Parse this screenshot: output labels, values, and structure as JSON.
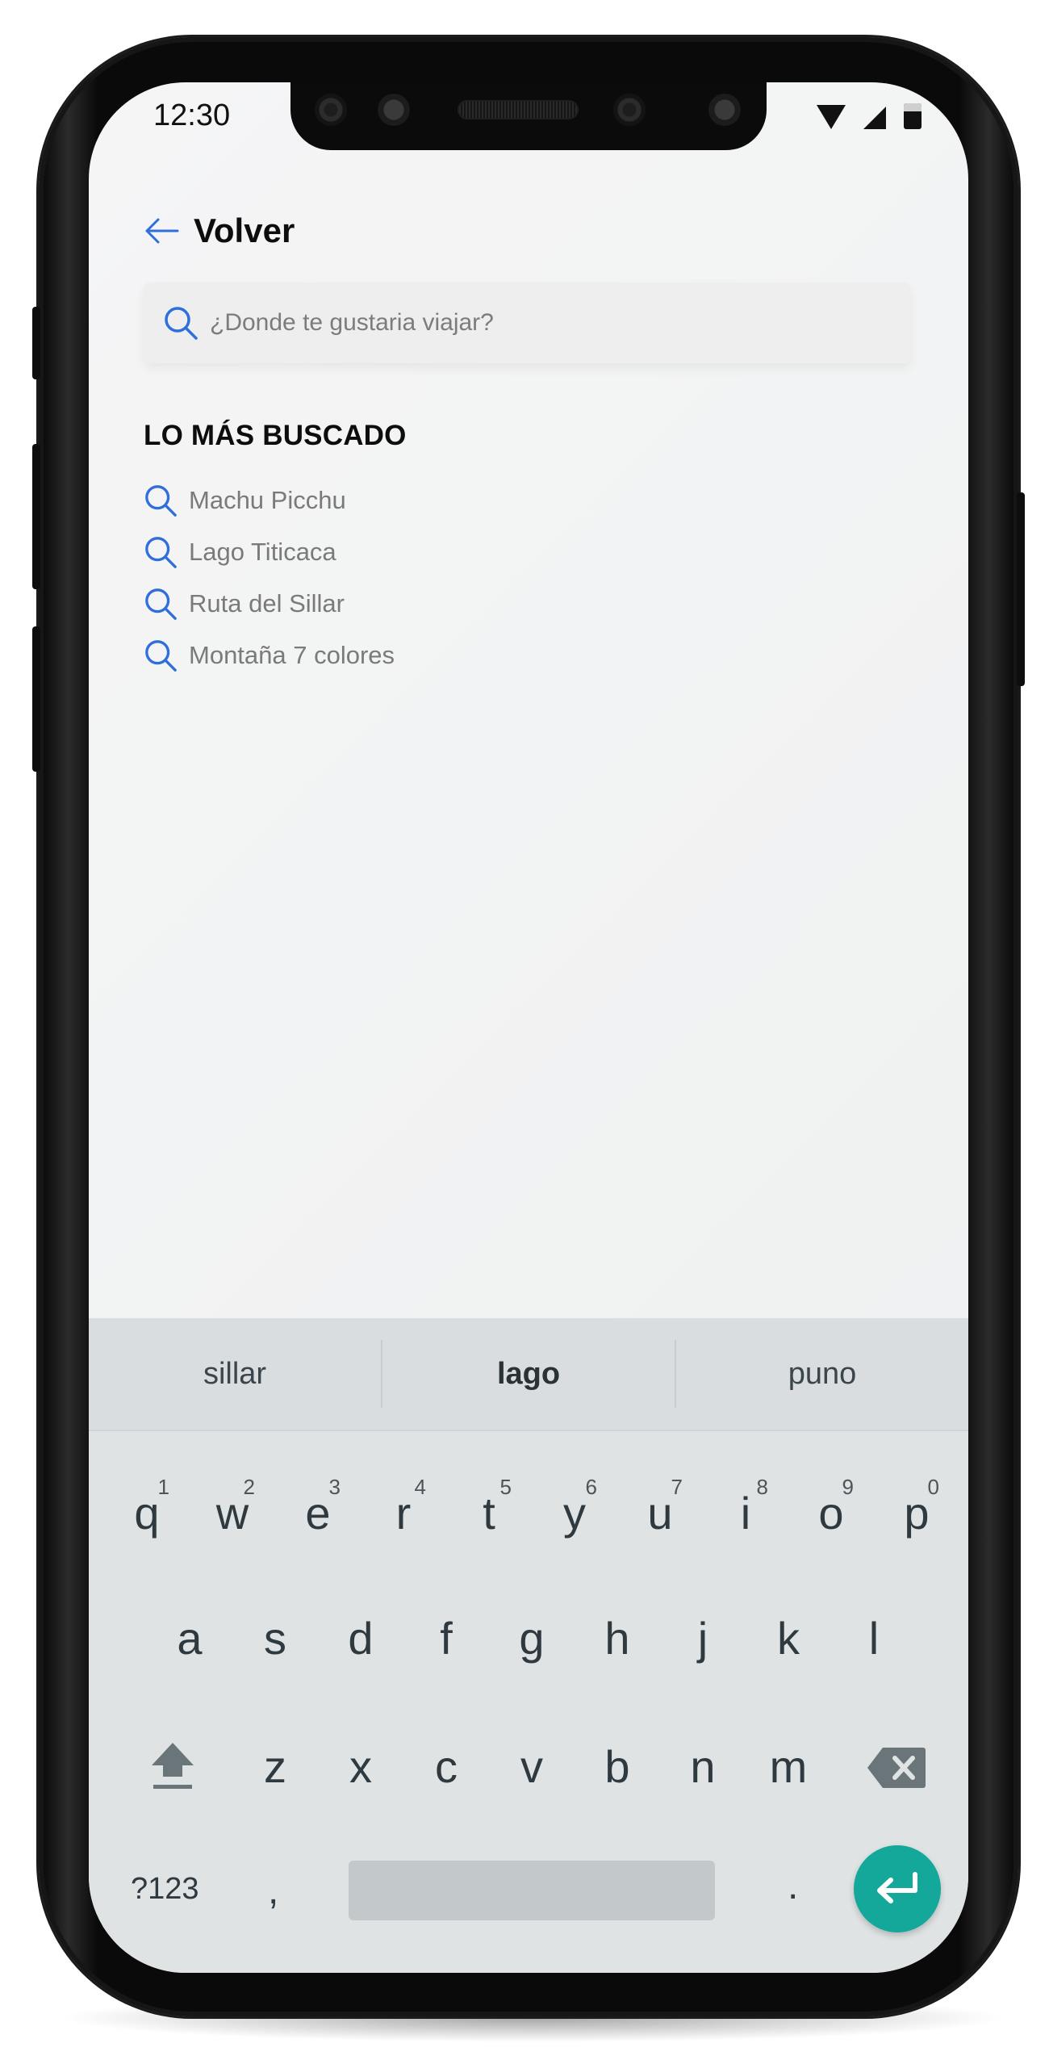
{
  "status_bar": {
    "time": "12:30"
  },
  "header": {
    "back_label": "Volver"
  },
  "search": {
    "placeholder": "¿Donde te gustaria viajar?"
  },
  "popular": {
    "title": "LO MÁS BUSCADO",
    "items": [
      {
        "label": "Machu Picchu"
      },
      {
        "label": "Lago Titicaca"
      },
      {
        "label": "Ruta del Sillar"
      },
      {
        "label": "Montaña 7 colores"
      }
    ]
  },
  "keyboard": {
    "suggestions": [
      "sillar",
      "lago",
      "puno"
    ],
    "row1": [
      {
        "letter": "q",
        "hint": "1"
      },
      {
        "letter": "w",
        "hint": "2"
      },
      {
        "letter": "e",
        "hint": "3"
      },
      {
        "letter": "r",
        "hint": "4"
      },
      {
        "letter": "t",
        "hint": "5"
      },
      {
        "letter": "y",
        "hint": "6"
      },
      {
        "letter": "u",
        "hint": "7"
      },
      {
        "letter": "i",
        "hint": "8"
      },
      {
        "letter": "o",
        "hint": "9"
      },
      {
        "letter": "p",
        "hint": "0"
      }
    ],
    "row2": [
      "a",
      "s",
      "d",
      "f",
      "g",
      "h",
      "j",
      "k",
      "l"
    ],
    "row3": [
      "z",
      "x",
      "c",
      "v",
      "b",
      "n",
      "m"
    ],
    "symbols_label": "?123",
    "comma_label": ",",
    "period_label": "."
  },
  "colors": {
    "accent": "#2f6fdb",
    "enter_button": "#14a89a",
    "keyboard_bg": "#dfe3e4"
  },
  "icons": {
    "back": "arrow-left-icon",
    "search": "search-icon",
    "shift": "shift-icon",
    "delete": "backspace-icon",
    "enter": "enter-icon"
  }
}
